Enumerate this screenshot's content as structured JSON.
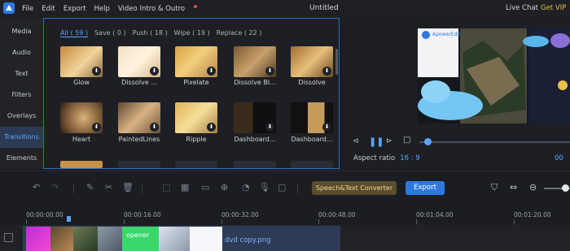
{
  "titlebar": {
    "menu": [
      "File",
      "Edit",
      "Export",
      "Help",
      "Video Intro & Outro"
    ],
    "title": "Untitled",
    "live_chat": "Live Chat",
    "get_vip": "Get VIP"
  },
  "left_nav": {
    "items": [
      "Media",
      "Audio",
      "Text",
      "Filters",
      "Overlays",
      "Transitions",
      "Elements"
    ],
    "active": "Transitions"
  },
  "library": {
    "tabs": [
      "All ( 59 )",
      "Save ( 0 )",
      "Push ( 18 )",
      "Wipe ( 19 )",
      "Replace ( 22 )"
    ],
    "active_tab": "All ( 59 )",
    "row1": [
      "Glow",
      "Dissolve ...",
      "Pixelate",
      "Dissolve Bl...",
      "Dissolve"
    ],
    "row2": [
      "Heart",
      "PaintedLines",
      "Ripple",
      "Dashboard...",
      "Dashboard..."
    ]
  },
  "preview": {
    "watermark_brand": "ApowerEdit",
    "aspect_label": "Aspect ratio",
    "aspect_value": "16 : 9",
    "timecode": "00",
    "playback_progress": 0.03
  },
  "toolbar": {
    "speech_btn": "Speech&Text Converter",
    "export_btn": "Export"
  },
  "timeline": {
    "ruler": [
      "00:00:00.00",
      "00:00:16.00",
      "00:00:32.00",
      "00:00:48.00",
      "00:01:04.00",
      "00:01:20.00"
    ],
    "clip_file": "dvd copy.png",
    "clip_texts": [
      "opener"
    ]
  },
  "colors": {
    "accent": "#2d79e0",
    "active_text": "#5aa6ff",
    "vip": "#e8c24a",
    "speech_bg": "#5a4d2e"
  }
}
